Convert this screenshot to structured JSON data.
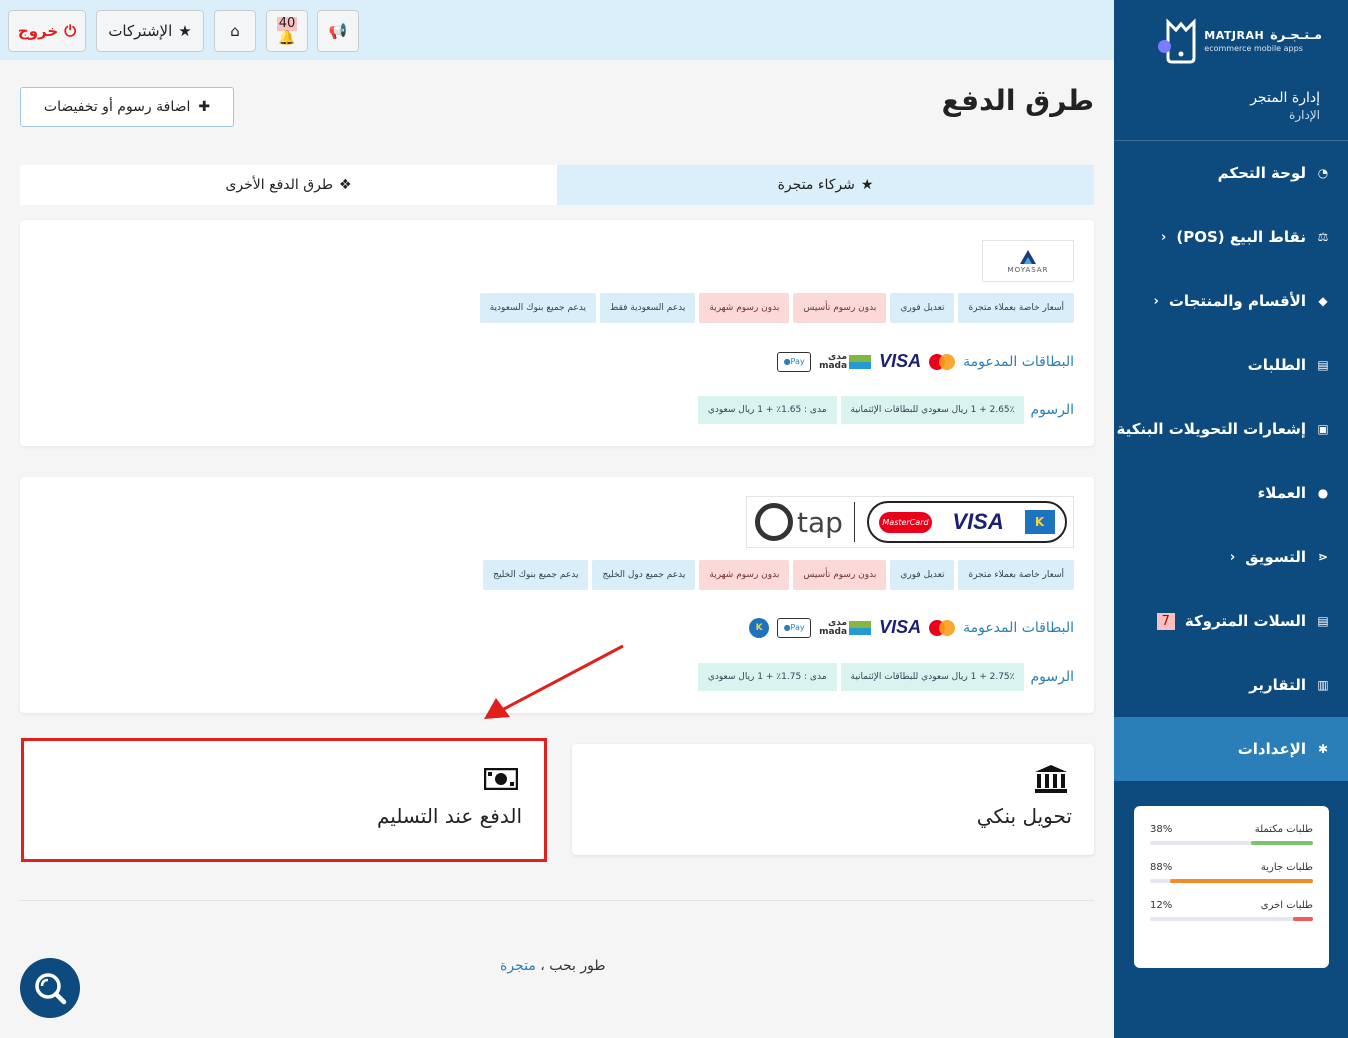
{
  "brand": {
    "name_en": "MATJRAH",
    "name_ar": "مـتـجـرة",
    "tagline": "ecommerce mobile apps"
  },
  "store_mgmt": {
    "title": "إدارة المتجر",
    "subtitle": "الإدارة"
  },
  "nav": [
    {
      "label": "لوحة التحكم",
      "icon": "dashboard-icon"
    },
    {
      "label": "نقاط البيع (POS)",
      "icon": "scale-icon",
      "has_submenu": true
    },
    {
      "label": "الأقسام والمنتجات",
      "icon": "tag-icon",
      "has_submenu": true
    },
    {
      "label": "الطلبات",
      "icon": "cart-icon"
    },
    {
      "label": "إشعارات التحويلات البنكية",
      "icon": "money-icon"
    },
    {
      "label": "العملاء",
      "icon": "user-icon"
    },
    {
      "label": "التسويق",
      "icon": "share-icon",
      "has_submenu": true
    },
    {
      "label": "السلات المتروكة",
      "icon": "cart-icon",
      "badge": "7"
    },
    {
      "label": "التقارير",
      "icon": "bar-chart-icon"
    },
    {
      "label": "الإعدادات",
      "icon": "gear-icon",
      "active": true
    }
  ],
  "stats": [
    {
      "label": "طلبات مكتملة",
      "value": "38%",
      "fraction": 0.38,
      "color": "#7cc36b"
    },
    {
      "label": "طلبات جارية",
      "value": "88%",
      "fraction": 0.88,
      "color": "#f28c28"
    },
    {
      "label": "طلبات اخرى",
      "value": "12%",
      "fraction": 0.12,
      "color": "#f05a5a"
    }
  ],
  "topbar": {
    "logout": "خروج",
    "subscriptions": "الإشتركات",
    "notifications_count": "40"
  },
  "page": {
    "title": "طرق الدفع",
    "add_fee": "اضافة رسوم أو تخفيضات"
  },
  "tabs": [
    {
      "label": "شركاء متجرة",
      "active": true
    },
    {
      "label": "طرق الدفع الأخرى",
      "active": false
    }
  ],
  "providers": {
    "moyasar": {
      "logo_text": "MOYASAR",
      "tags": [
        "أسعار خاصة بعملاء متجرة",
        "تعديل فوري",
        "بدون رسوم تأسيس",
        "بدون رسوم شهرية",
        "يدعم السعودية فقط",
        "يدعم جميع بنوك السعودية"
      ],
      "cards_label": "البطاقات المدعومة",
      "fees_label": "الرسوم",
      "fees": [
        "2.65٪ + 1 ريال سعودي للبطاقات الإئتمانية",
        "مدى : 1.65٪ + 1 ريال سعودي"
      ]
    },
    "tap": {
      "logo_text": "tap",
      "tags": [
        "أسعار خاصة بعملاء متجرة",
        "تعديل فوري",
        "بدون رسوم تأسيس",
        "بدون رسوم شهرية",
        "يدعم جميع دول الخليج",
        "يدعم جميع بنوك الخليج"
      ],
      "cards_label": "البطاقات المدعومة",
      "fees_label": "الرسوم",
      "fees": [
        "2.75٪ + 1 ريال سعودي للبطاقات الإئتمانية",
        "مدى : 1.75٪ + 1 ريال سعودي"
      ]
    }
  },
  "card_logos": {
    "visa": "VISA",
    "mada_ar": "مدى",
    "mada_en": "mada",
    "apple_pay": "Pay",
    "mastercard": "MasterCard"
  },
  "other_methods": {
    "bank_transfer": "تحويل بنكي",
    "cod": "الدفع عند التسليم"
  },
  "footer": {
    "prefix": "طور بحب ،",
    "link": "متجرة"
  }
}
